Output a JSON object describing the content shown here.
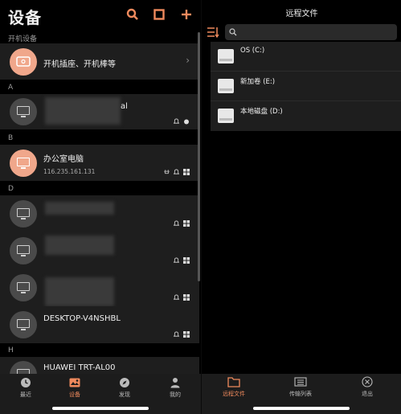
{
  "left": {
    "title": "设备",
    "section_power": "开机设备",
    "power_card_label": "开机插座、开机棒等",
    "groups": [
      {
        "letter": "A"
      },
      {
        "letter": "B"
      },
      {
        "letter": "D"
      },
      {
        "letter": "H"
      }
    ],
    "devices": {
      "a1_name_tail": "al",
      "b1_name": "办公室电脑",
      "b1_ip": "116.235.161.131",
      "d4_name": "DESKTOP-V4NSHBL",
      "h1_name": "HUAWEI TRT-AL00"
    },
    "tabs": [
      {
        "label": "最近",
        "icon": "clock-icon"
      },
      {
        "label": "设备",
        "icon": "devices-icon"
      },
      {
        "label": "发现",
        "icon": "compass-icon"
      },
      {
        "label": "我的",
        "icon": "user-icon"
      }
    ],
    "accent": "#f08a5d"
  },
  "right": {
    "title": "远程文件",
    "drives": [
      {
        "name": "OS (C:)"
      },
      {
        "name": "新加卷 (E:)"
      },
      {
        "name": "本地磁盘 (D:)"
      }
    ],
    "tabs": [
      {
        "label": "远程文件",
        "icon": "folder-icon"
      },
      {
        "label": "传输列表",
        "icon": "transfer-icon"
      },
      {
        "label": "退出",
        "icon": "exit-icon"
      }
    ]
  }
}
